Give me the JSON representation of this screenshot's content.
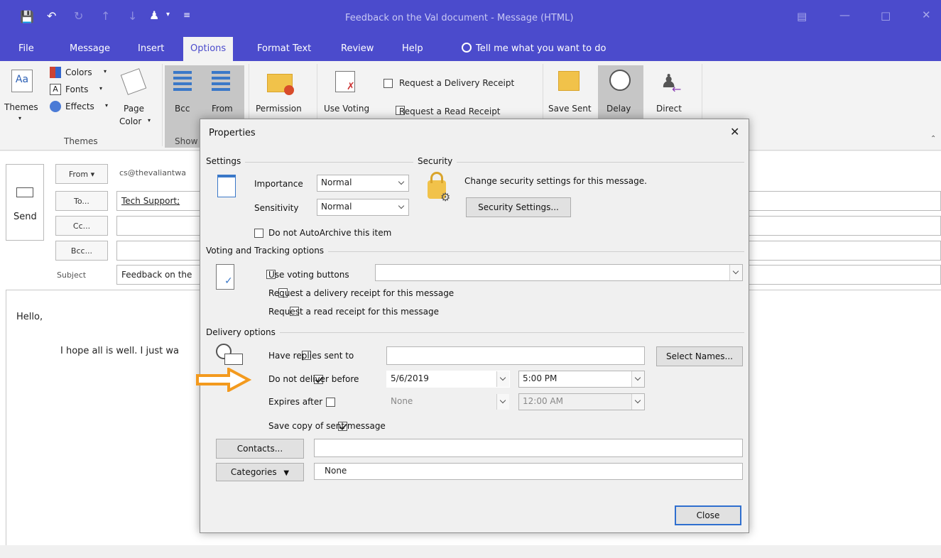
{
  "window": {
    "title": "Feedback on the Val document  -  Message (HTML)"
  },
  "tabs": [
    {
      "label": "File"
    },
    {
      "label": "Message"
    },
    {
      "label": "Insert"
    },
    {
      "label": "Options"
    },
    {
      "label": "Format Text"
    },
    {
      "label": "Review"
    },
    {
      "label": "Help"
    }
  ],
  "tell_me": "Tell me what you want to do",
  "ribbon": {
    "themes": "Themes",
    "colors": "Colors",
    "fonts": "Fonts",
    "effects": "Effects",
    "page_color_1": "Page",
    "page_color_2": "Color",
    "group_themes": "Themes",
    "bcc": "Bcc",
    "from": "From",
    "group_show": "Show",
    "permission": "Permission",
    "use_voting": "Use Voting",
    "request_delivery": "Request a Delivery Receipt",
    "request_read": "Request a Read Receipt",
    "save_sent": "Save Sent",
    "delay": "Delay",
    "direct": "Direct"
  },
  "compose": {
    "send": "Send",
    "from_btn": "From",
    "from_value": "cs@thevaliantwa",
    "to_btn": "To...",
    "to_value": "Tech Support;",
    "cc_btn": "Cc...",
    "bcc_btn": "Bcc...",
    "subject_label": "Subject",
    "subject_value": "Feedback on the",
    "body_greeting": "Hello,",
    "body_line": "I hope all is well. I just wa"
  },
  "dialog": {
    "title": "Properties",
    "settings": {
      "heading": "Settings",
      "importance_label": "Importance",
      "importance_value": "Normal",
      "sensitivity_label": "Sensitivity",
      "sensitivity_value": "Normal",
      "autoarchive": "Do not AutoArchive this item"
    },
    "security": {
      "heading": "Security",
      "text": "Change security settings for this message.",
      "button": "Security Settings..."
    },
    "voting": {
      "heading": "Voting and Tracking options",
      "use_voting": "Use voting buttons",
      "delivery_receipt": "Request a delivery receipt for this message",
      "read_receipt": "Request a read receipt for this message"
    },
    "delivery": {
      "heading": "Delivery options",
      "have_replies": "Have replies sent to",
      "select_names": "Select Names...",
      "do_not_deliver": "Do not deliver before",
      "deliver_date": "5/6/2019",
      "deliver_time": "5:00 PM",
      "expires_after": "Expires after",
      "expires_date": "None",
      "expires_time": "12:00 AM",
      "save_copy": "Save copy of sent message"
    },
    "contacts_btn": "Contacts...",
    "categories_btn": "Categories",
    "categories_value": "None",
    "close_btn": "Close"
  },
  "colors": {
    "accent": "#4b4bcc",
    "arrow": "#f39a1e"
  }
}
